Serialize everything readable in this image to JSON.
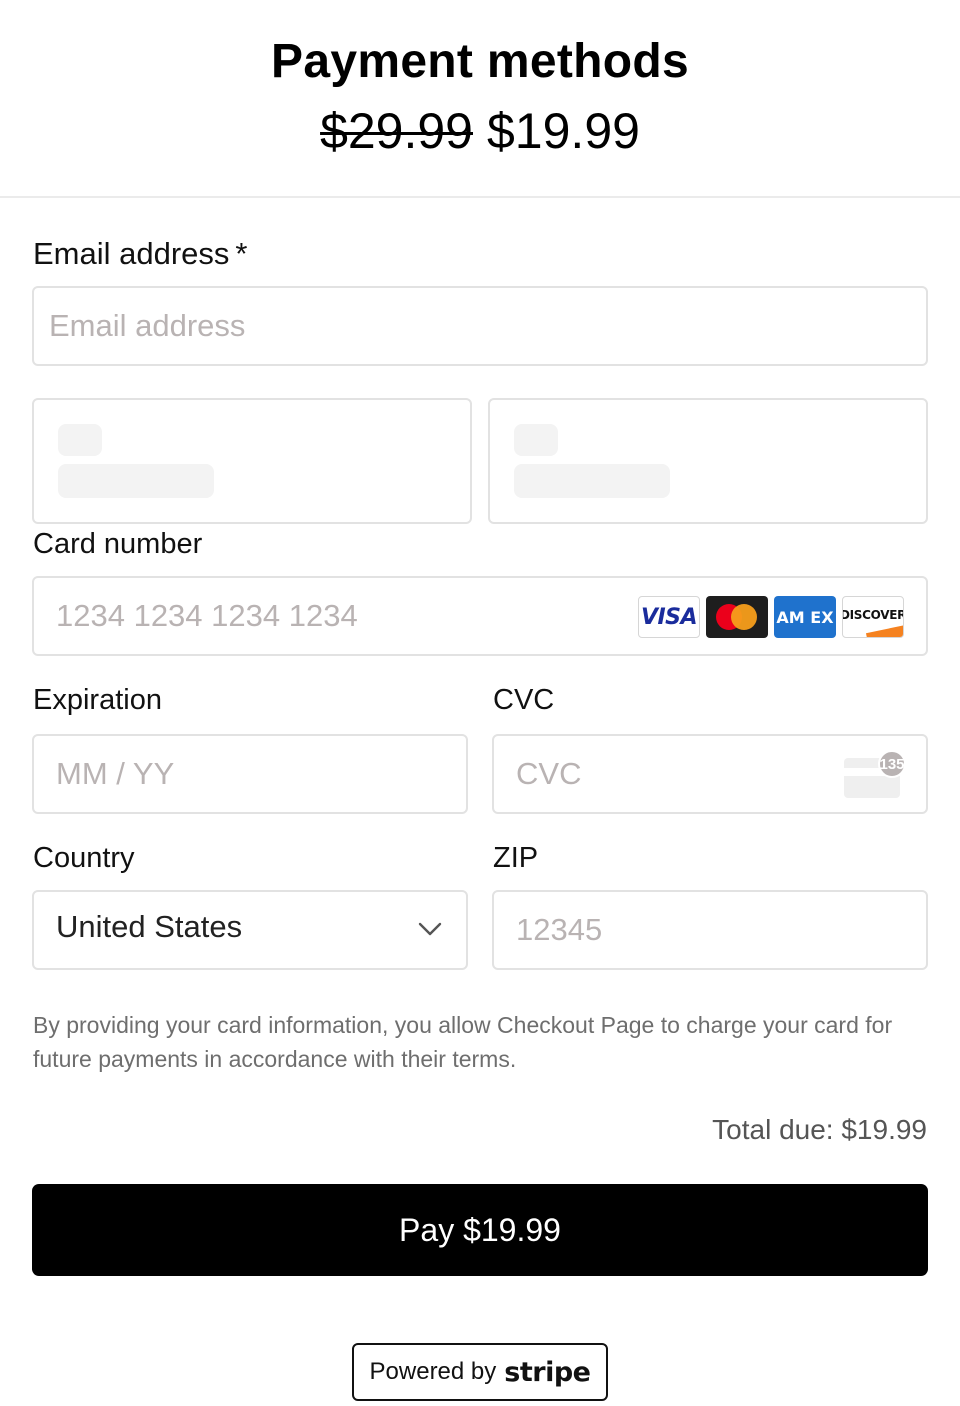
{
  "header": {
    "title": "Payment methods",
    "original_price": "$29.99",
    "price": "$19.99"
  },
  "email": {
    "label": "Email address",
    "required_mark": "*",
    "placeholder": "Email address",
    "value": ""
  },
  "card": {
    "label": "Card number",
    "placeholder": "1234 1234 1234 1234",
    "brands": [
      "VISA",
      "mastercard",
      "AM EX",
      "DISCOVER"
    ]
  },
  "expiration": {
    "label": "Expiration",
    "placeholder": "MM / YY"
  },
  "cvc": {
    "label": "CVC",
    "placeholder": "CVC",
    "icon_badge": "135"
  },
  "country": {
    "label": "Country",
    "selected": "United States"
  },
  "zip": {
    "label": "ZIP",
    "placeholder": "12345"
  },
  "legal_text": "By providing your card information, you allow Checkout Page to charge your card for future payments in accordance with their terms.",
  "total_due": "Total due: $19.99",
  "pay_button": "Pay $19.99",
  "powered_by": {
    "text": "Powered by",
    "brand": "stripe"
  },
  "colors": {
    "button_bg": "#000000",
    "border": "#e2e2e2",
    "placeholder": "#b9b3b3",
    "muted_text": "#6e6e6e"
  }
}
